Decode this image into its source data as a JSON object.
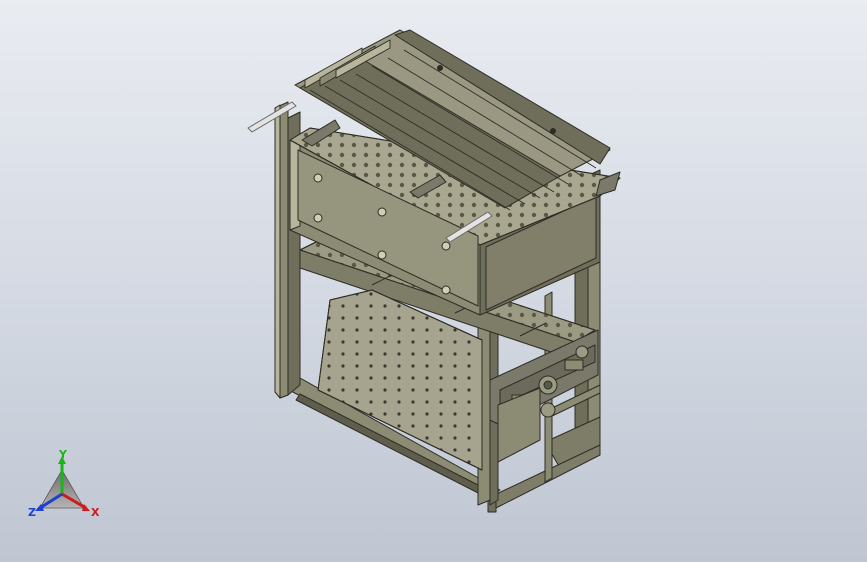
{
  "viewport": {
    "name": "cad-model-viewport",
    "background_top": "#e9ecf1",
    "background_bottom": "#bfc6d2"
  },
  "model": {
    "name": "perforated-frame-assembly",
    "body_color": "#8c8b74",
    "shadow_color": "#5f5e4c",
    "highlight_color": "#b7b59c",
    "edge_color": "#2e2d25",
    "handle_color": "#e3e3e3"
  },
  "triad": {
    "x_label": "X",
    "y_label": "Y",
    "z_label": "Z",
    "x_color": "#d11a1a",
    "y_color": "#1bb51b",
    "z_color": "#1f3fd1"
  }
}
